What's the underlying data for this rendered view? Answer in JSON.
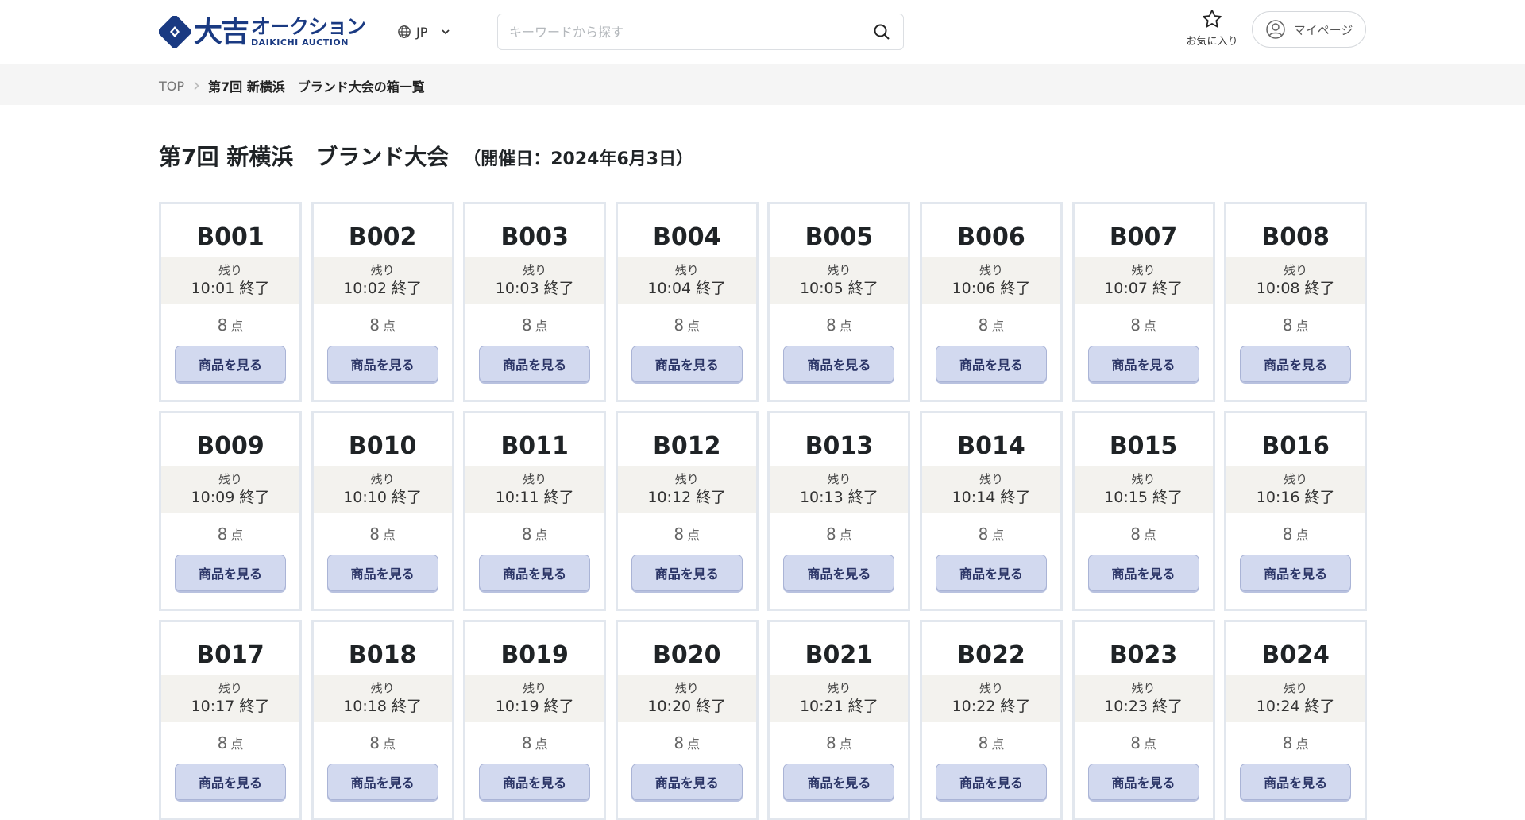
{
  "header": {
    "logo_kanji": "大吉",
    "logo_kana": "オークション",
    "logo_en": "DAIKICHI AUCTION",
    "language": "JP",
    "search_placeholder": "キーワードから探す",
    "favorites_label": "お気に入り",
    "mypage_label": "マイページ"
  },
  "breadcrumb": {
    "top": "TOP",
    "separator": ">",
    "current": "第7回 新横浜　ブランド大会の箱一覧"
  },
  "page": {
    "title": "第7回 新横浜　ブランド大会",
    "date": "（開催日：2024年6月3日）"
  },
  "colors": {
    "brand": "#1a3a82",
    "card_border": "#e2e7ee",
    "remain_bg": "#f3f2ee",
    "button_bg": "#d2d9ef",
    "button_text": "#2a3466"
  },
  "boxes": [
    {
      "code": "B001",
      "remain_label": "残り",
      "end_time": "10:01 終了",
      "count": "8",
      "unit": "点",
      "button": "商品を見る"
    },
    {
      "code": "B002",
      "remain_label": "残り",
      "end_time": "10:02 終了",
      "count": "8",
      "unit": "点",
      "button": "商品を見る"
    },
    {
      "code": "B003",
      "remain_label": "残り",
      "end_time": "10:03 終了",
      "count": "8",
      "unit": "点",
      "button": "商品を見る"
    },
    {
      "code": "B004",
      "remain_label": "残り",
      "end_time": "10:04 終了",
      "count": "8",
      "unit": "点",
      "button": "商品を見る"
    },
    {
      "code": "B005",
      "remain_label": "残り",
      "end_time": "10:05 終了",
      "count": "8",
      "unit": "点",
      "button": "商品を見る"
    },
    {
      "code": "B006",
      "remain_label": "残り",
      "end_time": "10:06 終了",
      "count": "8",
      "unit": "点",
      "button": "商品を見る"
    },
    {
      "code": "B007",
      "remain_label": "残り",
      "end_time": "10:07 終了",
      "count": "8",
      "unit": "点",
      "button": "商品を見る"
    },
    {
      "code": "B008",
      "remain_label": "残り",
      "end_time": "10:08 終了",
      "count": "8",
      "unit": "点",
      "button": "商品を見る"
    },
    {
      "code": "B009",
      "remain_label": "残り",
      "end_time": "10:09 終了",
      "count": "8",
      "unit": "点",
      "button": "商品を見る"
    },
    {
      "code": "B010",
      "remain_label": "残り",
      "end_time": "10:10 終了",
      "count": "8",
      "unit": "点",
      "button": "商品を見る"
    },
    {
      "code": "B011",
      "remain_label": "残り",
      "end_time": "10:11 終了",
      "count": "8",
      "unit": "点",
      "button": "商品を見る"
    },
    {
      "code": "B012",
      "remain_label": "残り",
      "end_time": "10:12 終了",
      "count": "8",
      "unit": "点",
      "button": "商品を見る"
    },
    {
      "code": "B013",
      "remain_label": "残り",
      "end_time": "10:13 終了",
      "count": "8",
      "unit": "点",
      "button": "商品を見る"
    },
    {
      "code": "B014",
      "remain_label": "残り",
      "end_time": "10:14 終了",
      "count": "8",
      "unit": "点",
      "button": "商品を見る"
    },
    {
      "code": "B015",
      "remain_label": "残り",
      "end_time": "10:15 終了",
      "count": "8",
      "unit": "点",
      "button": "商品を見る"
    },
    {
      "code": "B016",
      "remain_label": "残り",
      "end_time": "10:16 終了",
      "count": "8",
      "unit": "点",
      "button": "商品を見る"
    },
    {
      "code": "B017",
      "remain_label": "残り",
      "end_time": "10:17 終了",
      "count": "8",
      "unit": "点",
      "button": "商品を見る"
    },
    {
      "code": "B018",
      "remain_label": "残り",
      "end_time": "10:18 終了",
      "count": "8",
      "unit": "点",
      "button": "商品を見る"
    },
    {
      "code": "B019",
      "remain_label": "残り",
      "end_time": "10:19 終了",
      "count": "8",
      "unit": "点",
      "button": "商品を見る"
    },
    {
      "code": "B020",
      "remain_label": "残り",
      "end_time": "10:20 終了",
      "count": "8",
      "unit": "点",
      "button": "商品を見る"
    },
    {
      "code": "B021",
      "remain_label": "残り",
      "end_time": "10:21 終了",
      "count": "8",
      "unit": "点",
      "button": "商品を見る"
    },
    {
      "code": "B022",
      "remain_label": "残り",
      "end_time": "10:22 終了",
      "count": "8",
      "unit": "点",
      "button": "商品を見る"
    },
    {
      "code": "B023",
      "remain_label": "残り",
      "end_time": "10:23 終了",
      "count": "8",
      "unit": "点",
      "button": "商品を見る"
    },
    {
      "code": "B024",
      "remain_label": "残り",
      "end_time": "10:24 終了",
      "count": "8",
      "unit": "点",
      "button": "商品を見る"
    }
  ]
}
